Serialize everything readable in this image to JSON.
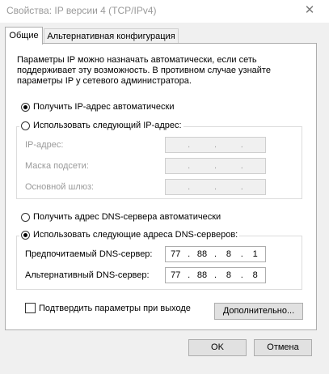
{
  "window": {
    "title": "Свойства: IP версии 4 (TCP/IPv4)",
    "close_glyph": "✕"
  },
  "tabs": [
    {
      "label": "Общие",
      "active": true
    },
    {
      "label": "Альтернативная конфигурация",
      "active": false
    }
  ],
  "description": "Параметры IP можно назначать автоматически, если сеть поддерживает эту возможность. В противном случае узнайте параметры IP у сетевого администратора.",
  "ip": {
    "auto_label": "Получить IP-адрес автоматически",
    "auto_selected": true,
    "manual_label": "Использовать следующий IP-адрес:",
    "manual_selected": false,
    "address_label": "IP-адрес:",
    "mask_label": "Маска подсети:",
    "gateway_label": "Основной шлюз:",
    "address_value": [
      "",
      "",
      "",
      ""
    ],
    "mask_value": [
      "",
      "",
      "",
      ""
    ],
    "gateway_value": [
      "",
      "",
      "",
      ""
    ]
  },
  "dns": {
    "auto_label": "Получить адрес DNS-сервера автоматически",
    "auto_selected": false,
    "manual_label": "Использовать следующие адреса DNS-серверов:",
    "manual_selected": true,
    "preferred_label": "Предпочитаемый DNS-сервер:",
    "alternate_label": "Альтернативный DNS-сервер:",
    "preferred_value": [
      "77",
      "88",
      "8",
      "1"
    ],
    "alternate_value": [
      "77",
      "88",
      "8",
      "8"
    ]
  },
  "validate": {
    "label": "Подтвердить параметры при выходе",
    "checked": false
  },
  "buttons": {
    "advanced": "Дополнительно...",
    "ok": "OK",
    "cancel": "Отмена"
  },
  "colors": {
    "panel_bg": "#ffffff",
    "window_bg": "#f0f0f0",
    "disabled_text": "#9a9a9a"
  }
}
